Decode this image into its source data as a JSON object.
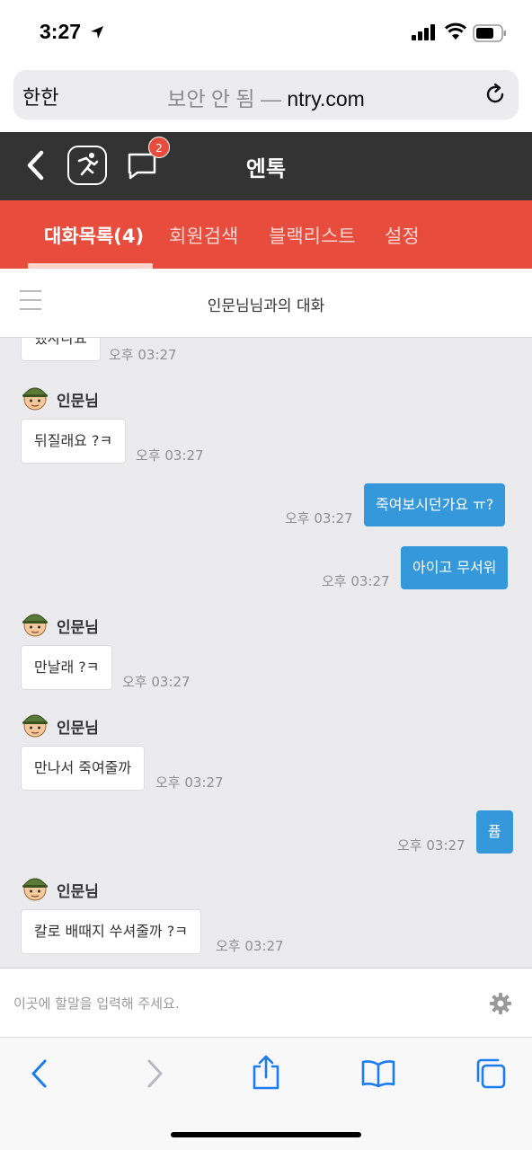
{
  "status_bar": {
    "time": "3:27"
  },
  "url_bar": {
    "aa_label": "한한",
    "security_text": "보안 안 됨 — ",
    "domain": "ntry.com"
  },
  "header": {
    "title": "엔톡",
    "notification_count": "2"
  },
  "tabs": [
    {
      "label": "대화목록(4)",
      "active": true
    },
    {
      "label": "회원검색"
    },
    {
      "label": "블랙리스트"
    },
    {
      "label": "설정"
    }
  ],
  "conversation": {
    "title": "인문님님과의 대화"
  },
  "messages": [
    {
      "dir": "in",
      "text": "했자나요",
      "time": "오후 03:27"
    },
    {
      "dir": "in",
      "sender": "인문님",
      "text": "뒤질래요 ?ㅋ",
      "time": "오후 03:27"
    },
    {
      "dir": "out",
      "text": "죽여보시던가요 ㅠ?",
      "time": "오후 03:27"
    },
    {
      "dir": "out",
      "text": "아이고 무서워",
      "time": "오후 03:27"
    },
    {
      "dir": "in",
      "sender": "인문님",
      "text": "만날래 ?ㅋ",
      "time": "오후 03:27"
    },
    {
      "dir": "in",
      "sender": "인문님",
      "text": "만나서 죽여줄까",
      "time": "오후 03:27"
    },
    {
      "dir": "out",
      "text": "퓹",
      "time": "오후 03:27"
    },
    {
      "dir": "in",
      "sender": "인문님",
      "text": "칼로 배때지 쑤셔줄까 ?ㅋ",
      "time": "오후 03:27"
    }
  ],
  "input": {
    "placeholder": "이곳에 할말을 입력해 주세요."
  },
  "colors": {
    "header_bg": "#333333",
    "tab_bg": "#e84c3d",
    "outgoing_bubble": "#3498db",
    "chat_bg": "#ebebed"
  },
  "icons": {
    "back": "chevron-left-icon",
    "logo": "runner-logo-icon",
    "chat": "chat-bubble-icon",
    "settings": "gear-icon",
    "toolbar": [
      "back-icon",
      "forward-icon",
      "share-icon",
      "bookmarks-icon",
      "tabs-icon"
    ]
  }
}
